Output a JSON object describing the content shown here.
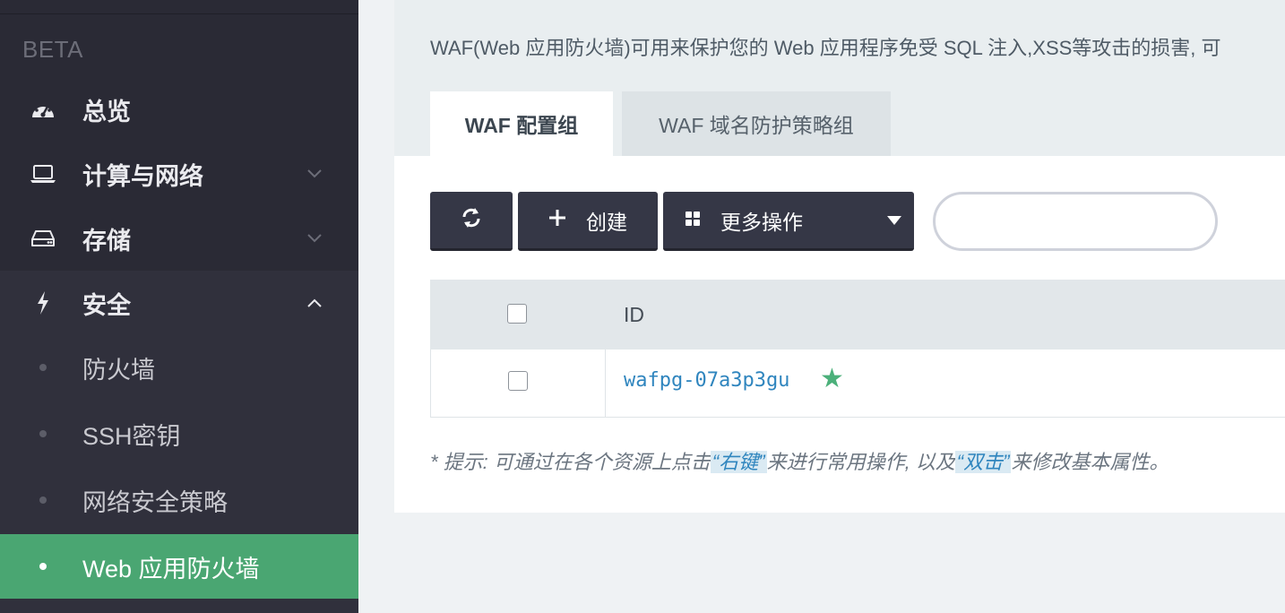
{
  "sidebar": {
    "beta_label": "BETA",
    "items": [
      {
        "label": "总览",
        "icon": "dashboard-icon"
      },
      {
        "label": "计算与网络",
        "icon": "laptop-icon"
      },
      {
        "label": "存储",
        "icon": "hdd-icon"
      },
      {
        "label": "安全",
        "icon": "bolt-icon"
      }
    ],
    "security_sub": [
      {
        "label": "防火墙"
      },
      {
        "label": "SSH密钥"
      },
      {
        "label": "网络安全策略"
      },
      {
        "label": "Web 应用防火墙",
        "active": true
      }
    ]
  },
  "main": {
    "description": "WAF(Web 应用防火墙)可用来保护您的 Web 应用程序免受 SQL 注入,XSS等攻击的损害, 可",
    "tabs": [
      {
        "label": "WAF 配置组",
        "active": true
      },
      {
        "label": "WAF 域名防护策略组",
        "active": false
      }
    ],
    "toolbar": {
      "refresh_icon": "refresh-icon",
      "create_label": "创建",
      "more_label": "更多操作"
    },
    "search": {
      "value": "",
      "placeholder": ""
    },
    "table": {
      "columns": [
        "ID"
      ],
      "rows": [
        {
          "id": "wafpg-07a3p3gu",
          "starred": true
        }
      ]
    },
    "hint": {
      "prefix": "* 提示: 可通过在各个资源上点击",
      "highlight1": "“右键”",
      "middle": "来进行常用操作, 以及",
      "highlight2": "“双击”",
      "suffix": "来修改基本属性。"
    }
  },
  "colors": {
    "sidebar_bg": "#2a2a35",
    "active_green": "#4aa672",
    "link_blue": "#2f85be",
    "star_green": "#4bb07a",
    "button_dark": "#353746"
  }
}
